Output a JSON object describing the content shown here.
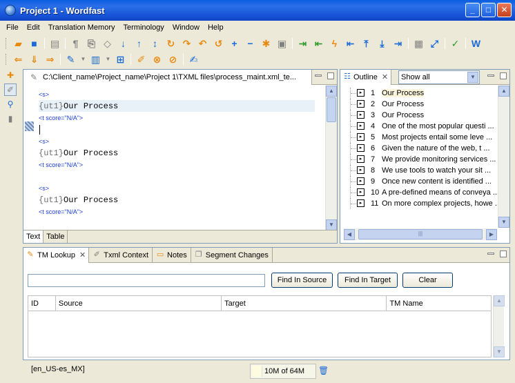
{
  "window": {
    "title": "Project 1 - Wordfast"
  },
  "menu": [
    "File",
    "Edit",
    "Translation Memory",
    "Terminology",
    "Window",
    "Help"
  ],
  "editor": {
    "tab_label": "C:\\Client_name\\Project_name\\Project 1\\TXML files\\process_maint.xml_te...",
    "lines": [
      {
        "kind": "tag",
        "text": "<s>"
      },
      {
        "kind": "seg",
        "prefix": "{ut1}",
        "text": "Our Process"
      },
      {
        "kind": "tag",
        "text": "<t score=\"N/A\">"
      },
      {
        "kind": "caret",
        "text": ""
      },
      {
        "kind": "tag",
        "text": "<s>"
      },
      {
        "kind": "seg",
        "prefix": "{ut1}",
        "text": "Our Process"
      },
      {
        "kind": "tag",
        "text": "<t score=\"N/A\">"
      },
      {
        "kind": "blank",
        "text": ""
      },
      {
        "kind": "tag",
        "text": "<s>"
      },
      {
        "kind": "seg",
        "prefix": "{ut1}",
        "text": "Our Process"
      },
      {
        "kind": "tag",
        "text": "<t score=\"N/A\">"
      }
    ],
    "bottom_tabs": [
      "Text",
      "Table"
    ]
  },
  "outline": {
    "tab_label": "Outline",
    "filter": "Show all",
    "items": [
      {
        "num": "1",
        "text": "Our Process"
      },
      {
        "num": "2",
        "text": "Our Process"
      },
      {
        "num": "3",
        "text": "Our Process"
      },
      {
        "num": "4",
        "text": "One of the most popular questi ..."
      },
      {
        "num": "5",
        "text": "Most projects entail some leve ..."
      },
      {
        "num": "6",
        "text": "Given the nature of the web, t ..."
      },
      {
        "num": "7",
        "text": "We provide monitoring services ..."
      },
      {
        "num": "8",
        "text": "We use tools to watch your sit ..."
      },
      {
        "num": "9",
        "text": "Once new content is identified ..."
      },
      {
        "num": "10",
        "text": "A pre-defined means of conveya ..."
      },
      {
        "num": "11",
        "text": "On more complex projects, howe ..."
      }
    ]
  },
  "bottom_panel": {
    "tabs": [
      "TM Lookup",
      "Txml Context",
      "Notes",
      "Segment Changes"
    ],
    "search_value": "",
    "buttons": {
      "find_source": "Find In Source",
      "find_target": "Find In Target",
      "clear": "Clear"
    },
    "columns": [
      "ID",
      "Source",
      "Target",
      "TM Name"
    ]
  },
  "status": {
    "locale": "[en_US-es_MX]",
    "memory": "10M of 64M"
  }
}
